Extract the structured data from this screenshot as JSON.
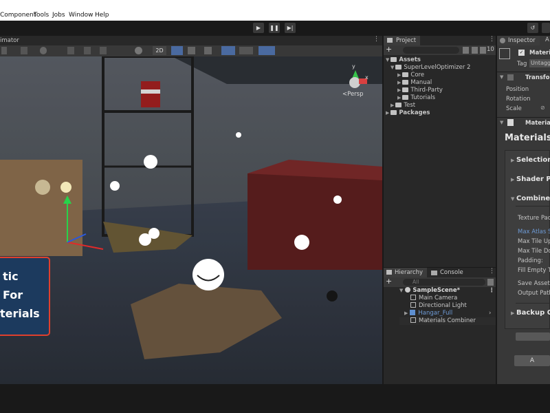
{
  "menu": [
    "Component",
    "Tools",
    "Jobs",
    "Window",
    "Help"
  ],
  "scene_view": {
    "tab_label": "imator",
    "toolbar_2d": "2D",
    "persp_label": "<Persp",
    "gizmo_y": "y",
    "gizmo_x": "x"
  },
  "overlay_banner": {
    "line1": "tic",
    "line2": "For",
    "line3": "terials"
  },
  "project": {
    "tab_label": "Project",
    "hidden_count": "10",
    "tree": [
      {
        "label": "Assets",
        "bold": true
      },
      {
        "label": "SuperLevelOptimizer 2"
      },
      {
        "label": "Core"
      },
      {
        "label": "Manual"
      },
      {
        "label": "Third-Party"
      },
      {
        "label": "Tutorials"
      },
      {
        "label": "Test"
      },
      {
        "label": "Packages",
        "bold": true
      }
    ]
  },
  "hierarchy": {
    "tab_label": "Hierarchy",
    "tab2_label": "Console",
    "search_placeholder": "All",
    "items": [
      {
        "label": "SampleScene*"
      },
      {
        "label": "Main Camera"
      },
      {
        "label": "Directional Light"
      },
      {
        "label": "Hangar_Full"
      },
      {
        "label": "Materials Combiner"
      }
    ]
  },
  "inspector": {
    "tab_label": "Inspector",
    "tab2_label": "A",
    "object_name": "Materia",
    "tag_label": "Tag",
    "tag_value": "Untagg",
    "transform_label": "Transfor",
    "transform_rows": [
      "Position",
      "Rotation",
      "Scale"
    ],
    "component_label": "Materials",
    "component_title": "MaterialsC",
    "sections": [
      "Selection",
      "Shader Pr",
      "Combine C",
      "Backup O"
    ],
    "combine_rows": [
      "Texture Pac",
      "Max Atlas S",
      "Max Tile Up",
      "Max Tile Do",
      "Padding:",
      "Fill Empty T",
      "Save Assets",
      "Output Path"
    ],
    "bottom_button": "A"
  },
  "colors": {
    "accent_blue": "#6e9bd6",
    "banner_border": "#e0402d",
    "banner_bg": "#1c3a5e"
  }
}
